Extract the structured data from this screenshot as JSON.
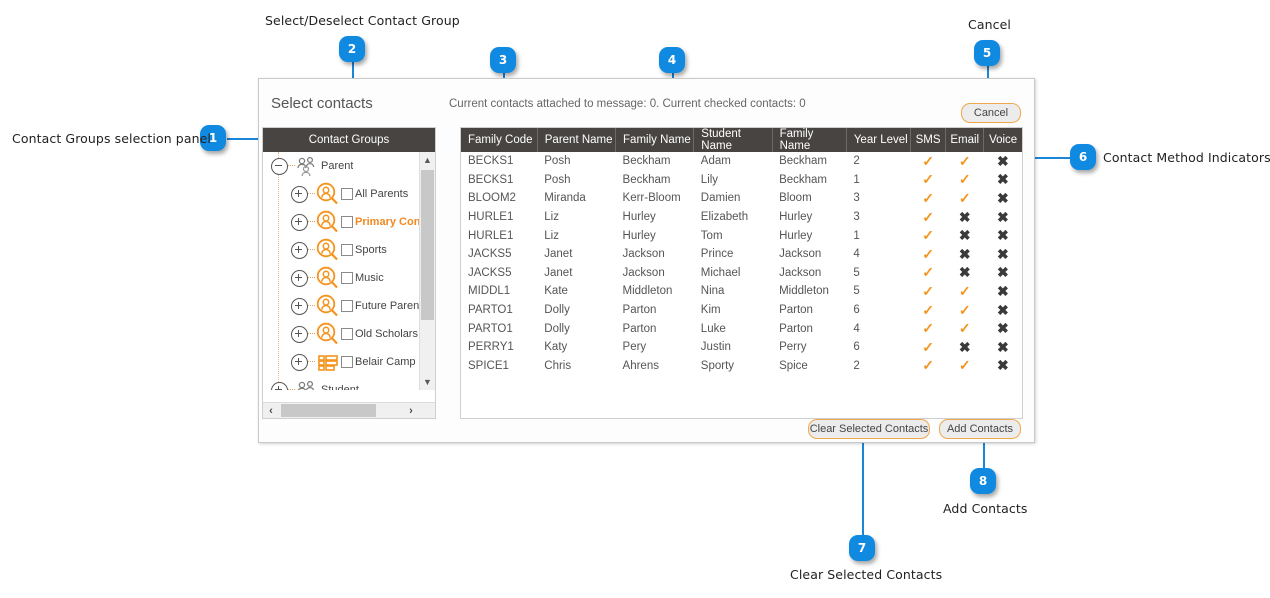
{
  "dialog": {
    "title": "Select contacts",
    "status": "Current contacts attached to message: 0. Current checked contacts: 0",
    "cancel_label": "Cancel",
    "clear_label": "Clear Selected Contacts",
    "add_label": "Add Contacts"
  },
  "tree": {
    "header": "Contact Groups",
    "nodes": [
      {
        "label": "Parent",
        "icon": "group-people-icon",
        "expander": "minus",
        "checkbox": false,
        "indent": 0,
        "highlight": false
      },
      {
        "label": "All Parents",
        "icon": "person-search-icon",
        "expander": "plus",
        "checkbox": true,
        "indent": 1,
        "highlight": false
      },
      {
        "label": "Primary Cont",
        "icon": "person-search-icon",
        "expander": "plus",
        "checkbox": true,
        "indent": 1,
        "highlight": true
      },
      {
        "label": "Sports",
        "icon": "person-search-icon",
        "expander": "plus",
        "checkbox": true,
        "indent": 1,
        "highlight": false
      },
      {
        "label": "Music",
        "icon": "person-search-icon",
        "expander": "plus",
        "checkbox": true,
        "indent": 1,
        "highlight": false
      },
      {
        "label": "Future Parents",
        "icon": "person-search-icon",
        "expander": "plus",
        "checkbox": true,
        "indent": 1,
        "highlight": false
      },
      {
        "label": "Old Scholars",
        "icon": "person-search-icon",
        "expander": "plus",
        "checkbox": true,
        "indent": 1,
        "highlight": false
      },
      {
        "label": "Belair Camp",
        "icon": "list-grid-icon",
        "expander": "plus",
        "checkbox": true,
        "indent": 1,
        "highlight": false
      },
      {
        "label": "Student",
        "icon": "group-people-icon",
        "expander": "plus",
        "checkbox": false,
        "indent": 0,
        "highlight": false
      }
    ]
  },
  "grid": {
    "columns": [
      "Family Code",
      "Parent Name",
      "Family Name",
      "Student Name",
      "Family Name",
      "Year Level",
      "SMS",
      "Email",
      "Voice"
    ],
    "rows": [
      {
        "family_code": "BECKS1",
        "parent_name": "Posh",
        "parent_family": "Beckham",
        "student_name": "Adam",
        "student_family": "Beckham",
        "year_level": "2",
        "sms": "tick",
        "email": "tick",
        "voice": "cross"
      },
      {
        "family_code": "BECKS1",
        "parent_name": "Posh",
        "parent_family": "Beckham",
        "student_name": "Lily",
        "student_family": "Beckham",
        "year_level": "1",
        "sms": "tick",
        "email": "tick",
        "voice": "cross"
      },
      {
        "family_code": "BLOOM2",
        "parent_name": "Miranda",
        "parent_family": "Kerr-Bloom",
        "student_name": "Damien",
        "student_family": "Bloom",
        "year_level": "3",
        "sms": "tick",
        "email": "tick",
        "voice": "cross"
      },
      {
        "family_code": "HURLE1",
        "parent_name": "Liz",
        "parent_family": "Hurley",
        "student_name": "Elizabeth",
        "student_family": "Hurley",
        "year_level": "3",
        "sms": "tick",
        "email": "cross",
        "voice": "cross"
      },
      {
        "family_code": "HURLE1",
        "parent_name": "Liz",
        "parent_family": "Hurley",
        "student_name": "Tom",
        "student_family": "Hurley",
        "year_level": "1",
        "sms": "tick",
        "email": "cross",
        "voice": "cross"
      },
      {
        "family_code": "JACKS5",
        "parent_name": "Janet",
        "parent_family": "Jackson",
        "student_name": "Prince",
        "student_family": "Jackson",
        "year_level": "4",
        "sms": "tick",
        "email": "cross",
        "voice": "cross"
      },
      {
        "family_code": "JACKS5",
        "parent_name": "Janet",
        "parent_family": "Jackson",
        "student_name": "Michael",
        "student_family": "Jackson",
        "year_level": "5",
        "sms": "tick",
        "email": "cross",
        "voice": "cross"
      },
      {
        "family_code": "MIDDL1",
        "parent_name": "Kate",
        "parent_family": "Middleton",
        "student_name": "Nina",
        "student_family": "Middleton",
        "year_level": "5",
        "sms": "tick",
        "email": "tick",
        "voice": "cross"
      },
      {
        "family_code": "PARTO1",
        "parent_name": "Dolly",
        "parent_family": "Parton",
        "student_name": "Kim",
        "student_family": "Parton",
        "year_level": "6",
        "sms": "tick",
        "email": "tick",
        "voice": "cross"
      },
      {
        "family_code": "PARTO1",
        "parent_name": "Dolly",
        "parent_family": "Parton",
        "student_name": "Luke",
        "student_family": "Parton",
        "year_level": "4",
        "sms": "tick",
        "email": "tick",
        "voice": "cross"
      },
      {
        "family_code": "PERRY1",
        "parent_name": "Katy",
        "parent_family": "Pery",
        "student_name": "Justin",
        "student_family": "Perry",
        "year_level": "6",
        "sms": "tick",
        "email": "cross",
        "voice": "cross"
      },
      {
        "family_code": "SPICE1",
        "parent_name": "Chris",
        "parent_family": "Ahrens",
        "student_name": "Sporty",
        "student_family": "Spice",
        "year_level": "2",
        "sms": "tick",
        "email": "tick",
        "voice": "cross"
      }
    ]
  },
  "callouts": [
    {
      "number": "1",
      "label": "Contact Groups selection panel"
    },
    {
      "number": "2",
      "label": "Select/Deselect Contact Group"
    },
    {
      "number": "3",
      "label": ""
    },
    {
      "number": "4",
      "label": ""
    },
    {
      "number": "5",
      "label": "Cancel"
    },
    {
      "number": "6",
      "label": "Contact Method Indicators"
    },
    {
      "number": "7",
      "label": "Clear Selected Contacts"
    },
    {
      "number": "8",
      "label": "Add Contacts"
    }
  ],
  "colors": {
    "accent_orange": "#f3941d",
    "badge_blue": "#1089e0",
    "header_dark": "#474442"
  }
}
